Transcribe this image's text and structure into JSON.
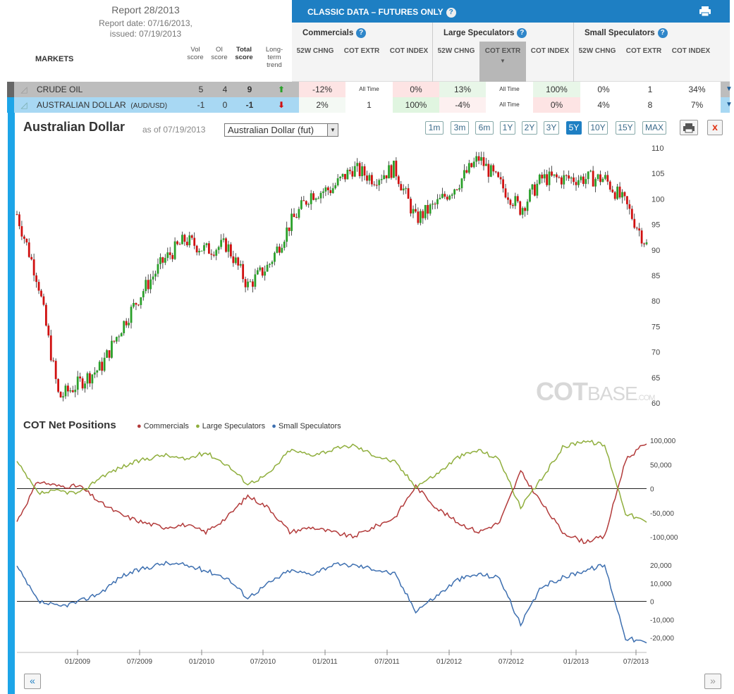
{
  "report": {
    "title": "Report 28/2013",
    "date": "Report date: 07/16/2013,",
    "issued": "issued: 07/19/2013",
    "markets_label": "MARKETS",
    "cols": {
      "vol": "Vol score",
      "oi": "OI score",
      "total": "Total score",
      "trend": "Long-term trend"
    }
  },
  "classic": {
    "title": "CLASSIC DATA – FUTURES ONLY",
    "help": "?"
  },
  "groups": [
    {
      "title": "Commercials",
      "cols": [
        "52W CHNG",
        "COT EXTR",
        "COT INDEX"
      ]
    },
    {
      "title": "Large Speculators",
      "cols": [
        "52W CHNG",
        "COT EXTR",
        "COT INDEX"
      ]
    },
    {
      "title": "Small Speculators",
      "cols": [
        "52W CHNG",
        "COT EXTR",
        "COT INDEX"
      ]
    }
  ],
  "rows": [
    {
      "name": "CRUDE OIL",
      "sub": "",
      "vol": "5",
      "oi": "4",
      "total": "9",
      "trend": "up",
      "c52": "-12%",
      "cext": "All Time",
      "cidx": "0%",
      "l52": "13%",
      "lext": "All Time",
      "lidx": "100%",
      "s52": "0%",
      "sext": "1",
      "sidx": "34%"
    },
    {
      "name": "AUSTRALIAN DOLLAR",
      "sub": "(AUD/USD)",
      "vol": "-1",
      "oi": "0",
      "total": "-1",
      "trend": "down",
      "c52": "2%",
      "cext": "1",
      "cidx": "100%",
      "l52": "-4%",
      "lext": "All Time",
      "lidx": "0%",
      "s52": "4%",
      "sext": "8",
      "sidx": "7%"
    }
  ],
  "chart": {
    "title": "Australian Dollar",
    "asof": "as of 07/19/2013",
    "select": "Australian Dollar (fut)",
    "timeframes": [
      "1m",
      "3m",
      "6m",
      "1Y",
      "2Y",
      "3Y",
      "5Y",
      "10Y",
      "15Y",
      "MAX"
    ],
    "active": "5Y",
    "close": "x",
    "watermark_a": "COT",
    "watermark_b": "BASE",
    "watermark_c": ".COM"
  },
  "cot": {
    "title": "COT Net Positions",
    "legend": [
      "Commercials",
      "Large Speculators",
      "Small Speculators"
    ]
  },
  "colors": {
    "commercials": "#b23a3a",
    "large": "#8fae3c",
    "small": "#3d6fb0",
    "up": "#2aa02a",
    "down": "#d01010",
    "accent": "#1e7fc3"
  },
  "chart_data": [
    {
      "type": "candlestick",
      "title": "Australian Dollar",
      "x_range": [
        "08/2008",
        "07/2013"
      ],
      "ylim": [
        60,
        110
      ],
      "yticks": [
        60,
        65,
        70,
        75,
        80,
        85,
        90,
        95,
        100,
        105,
        110
      ],
      "xticks": [
        "01/2009",
        "07/2009",
        "01/2010",
        "07/2010",
        "01/2011",
        "07/2011",
        "01/2012",
        "07/2012",
        "01/2013",
        "07/2013"
      ],
      "x": [
        "08/2008",
        "10/2008",
        "12/2008",
        "02/2009",
        "04/2009",
        "06/2009",
        "08/2009",
        "10/2009",
        "12/2009",
        "02/2010",
        "04/2010",
        "06/2010",
        "08/2010",
        "10/2010",
        "12/2010",
        "02/2011",
        "04/2011",
        "06/2011",
        "08/2011",
        "10/2011",
        "12/2011",
        "02/2012",
        "04/2012",
        "06/2012",
        "08/2012",
        "10/2012",
        "12/2012",
        "02/2013",
        "04/2013",
        "06/2013",
        "07/2013"
      ],
      "close": [
        97,
        84,
        61,
        64,
        67,
        75,
        82,
        88,
        92,
        90,
        91,
        83,
        87,
        95,
        101,
        102,
        106,
        104,
        106,
        96,
        99,
        103,
        108,
        103,
        98,
        104,
        104,
        104,
        104,
        99,
        91
      ]
    },
    {
      "type": "line",
      "title": "COT Net Positions",
      "ylim": [
        -110000,
        110000
      ],
      "yticks": [
        100000,
        50000,
        0,
        -50000,
        -100000
      ],
      "x": [
        "08/2008",
        "10/2008",
        "12/2008",
        "02/2009",
        "04/2009",
        "06/2009",
        "08/2009",
        "10/2009",
        "12/2009",
        "02/2010",
        "04/2010",
        "06/2010",
        "08/2010",
        "10/2010",
        "12/2010",
        "02/2011",
        "04/2011",
        "06/2011",
        "08/2011",
        "10/2011",
        "12/2011",
        "02/2012",
        "04/2012",
        "06/2012",
        "08/2012",
        "10/2012",
        "12/2012",
        "02/2013",
        "04/2013",
        "06/2013",
        "07/2013"
      ],
      "series": [
        {
          "name": "Commercials",
          "values": [
            -68000,
            15000,
            5000,
            5000,
            -30000,
            -55000,
            -70000,
            -80000,
            -75000,
            -90000,
            -60000,
            -15000,
            -40000,
            -90000,
            -80000,
            -90000,
            -100000,
            -80000,
            -60000,
            5000,
            -40000,
            -70000,
            -90000,
            -70000,
            35000,
            -30000,
            -90000,
            -110000,
            -100000,
            60000,
            95000
          ]
        },
        {
          "name": "Large Speculators",
          "values": [
            55000,
            -10000,
            -5000,
            -10000,
            25000,
            45000,
            60000,
            70000,
            60000,
            75000,
            50000,
            10000,
            30000,
            80000,
            70000,
            80000,
            90000,
            70000,
            55000,
            5000,
            30000,
            65000,
            80000,
            60000,
            -40000,
            20000,
            85000,
            100000,
            90000,
            -50000,
            -70000
          ]
        }
      ]
    },
    {
      "type": "line",
      "title": "",
      "ylim": [
        -28000,
        28000
      ],
      "yticks": [
        20000,
        10000,
        0,
        -10000,
        -20000
      ],
      "x": [
        "08/2008",
        "10/2008",
        "12/2008",
        "02/2009",
        "04/2009",
        "06/2009",
        "08/2009",
        "10/2009",
        "12/2009",
        "02/2010",
        "04/2010",
        "06/2010",
        "08/2010",
        "10/2010",
        "12/2010",
        "02/2011",
        "04/2011",
        "06/2011",
        "08/2011",
        "10/2011",
        "12/2011",
        "02/2012",
        "04/2012",
        "06/2012",
        "08/2012",
        "10/2012",
        "12/2012",
        "02/2013",
        "04/2013",
        "06/2013",
        "07/2013"
      ],
      "series": [
        {
          "name": "Small Speculators",
          "values": [
            19000,
            0,
            -3000,
            0,
            5000,
            14000,
            18000,
            21000,
            20000,
            17000,
            13000,
            2000,
            10000,
            17000,
            15000,
            20000,
            20000,
            18000,
            15000,
            -5000,
            3000,
            12000,
            15000,
            13000,
            -13000,
            8000,
            13000,
            17000,
            20000,
            -20000,
            -23000
          ]
        }
      ]
    }
  ]
}
